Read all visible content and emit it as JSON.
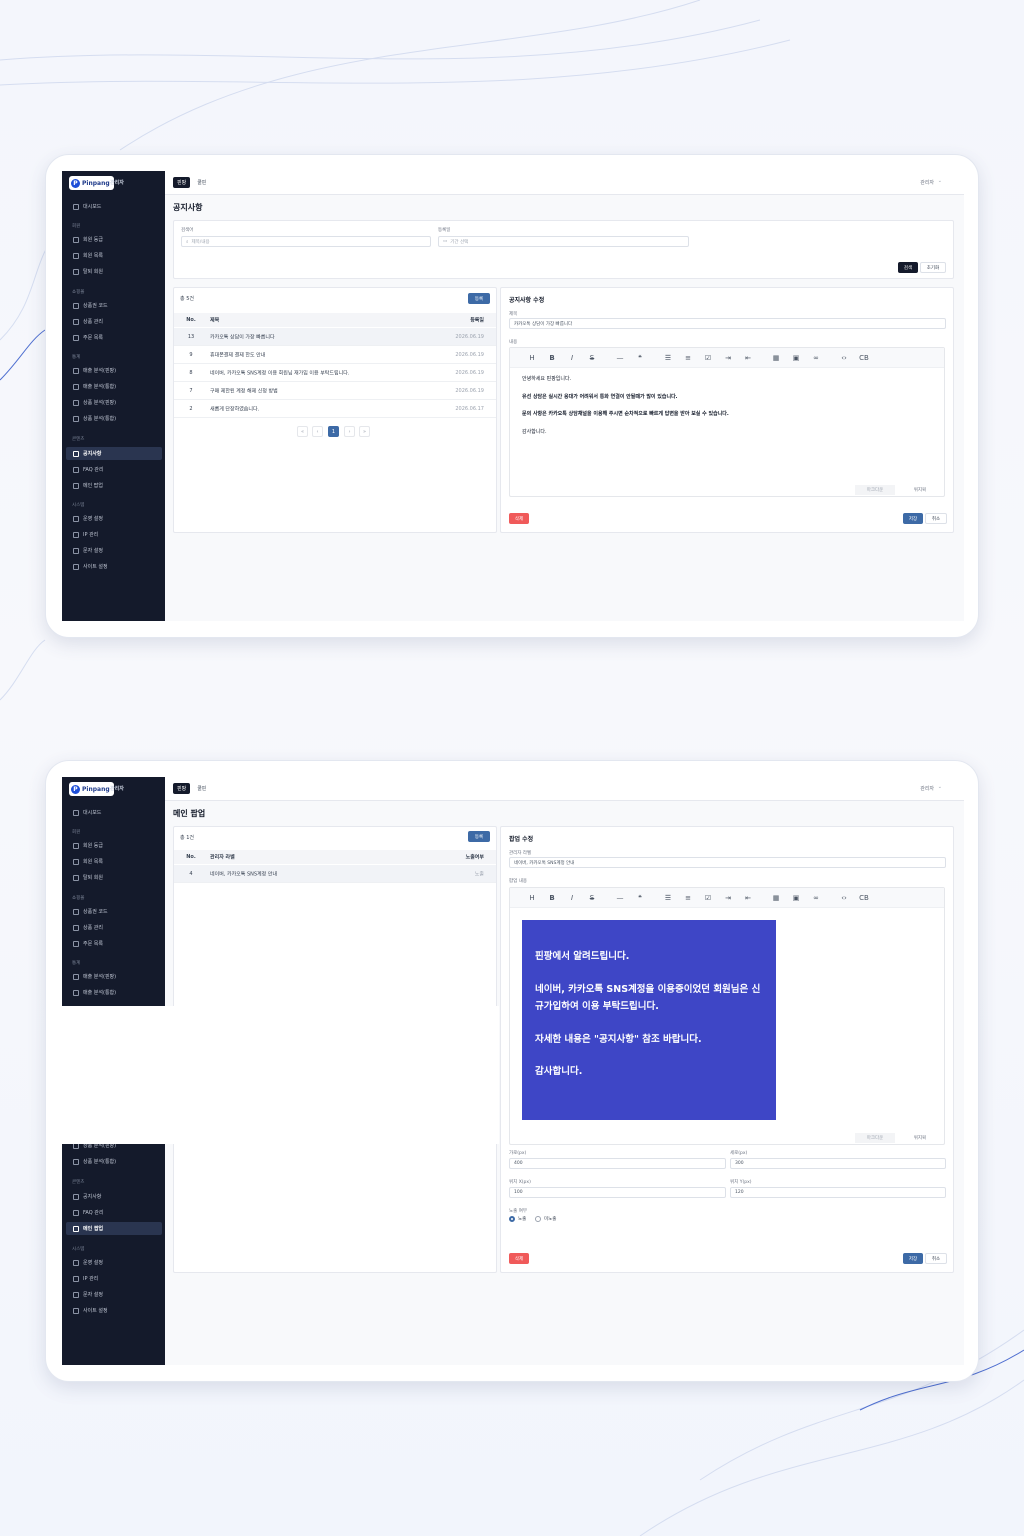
{
  "brand": {
    "logo_letter": "P",
    "logo_text": "Pinpang",
    "admin_tag": "관리자"
  },
  "topbar": {
    "tabs": [
      "핀팡",
      "쿨핀"
    ],
    "user": "관리자",
    "chevron": "⌄"
  },
  "sidebar": {
    "dashboard": "대시보드",
    "sections": {
      "member": "회원",
      "shopping": "쇼핑몰",
      "stats": "통계",
      "content": "콘텐츠",
      "system": "시스템"
    },
    "items": {
      "member_grade": "회원 등급",
      "member_list": "회원 목록",
      "withdrawn": "탈퇴 회원",
      "voucher_code": "상품권 코드",
      "product_mgmt": "상품 관리",
      "order_list": "주문 목록",
      "sales_pinpang": "매출 분석(핀팡)",
      "sales_total": "매출 분석(통합)",
      "product_pinpang": "상품 분석(핀팡)",
      "product_total": "상품 분석(통합)",
      "notice": "공지사항",
      "faq": "FAQ 관리",
      "main_popup": "메인 팝업",
      "operation": "운영 설정",
      "ip": "IP 관리",
      "sms": "문자 설정",
      "site": "사이트 설정"
    }
  },
  "screen1": {
    "page_title": "공지사항",
    "filter": {
      "keyword_label": "검색어",
      "keyword_placeholder": "제목/내용",
      "date_label": "등록일",
      "date_placeholder": "기간 선택",
      "search_button": "검색",
      "reset_button": "초기화"
    },
    "list": {
      "count": "총 5건",
      "register_button": "등록",
      "headers": [
        "No.",
        "제목",
        "등록일"
      ],
      "rows": [
        {
          "no": "13",
          "title": "카카오톡 상담이 가장 빠릅니다",
          "date": "2026.06.19"
        },
        {
          "no": "9",
          "title": "휴대폰결제 결제 한도 안내",
          "date": "2026.06.19"
        },
        {
          "no": "8",
          "title": "네이버, 카카오톡 SNS계정 이용 회원님 재가입 이용 부탁드립니다.",
          "date": "2026.06.19"
        },
        {
          "no": "7",
          "title": "구매 제한된 계정 해제 신청 방법",
          "date": "2026.06.19"
        },
        {
          "no": "2",
          "title": "새롭게 단장하였습니다.",
          "date": "2026.06.17"
        }
      ],
      "pagination": [
        "«",
        "‹",
        "1",
        "›",
        "»"
      ]
    },
    "edit": {
      "title": "공지사항 수정",
      "subject_label": "제목",
      "subject_value": "카카오톡 상담이 가장 빠릅니다",
      "content_label": "내용",
      "content": [
        "안녕하세요 핀팡입니다.",
        "유선 상담은 실시간 응대가 어려워서 통화 연결이 안될때가 많이 있습니다.",
        "문의 사항은 카카오톡 상담채널을 이용해 주시면 순차적으로 빠르게 답변을 받아 보실 수 있습니다.",
        "감사합니다."
      ],
      "markdown_tab": "마크다운",
      "wysiwyg_tab": "위지윅",
      "delete_button": "삭제",
      "save_button": "저장",
      "cancel_button": "취소"
    }
  },
  "screen2": {
    "page_title": "메인 팝업",
    "list": {
      "count": "총 1건",
      "register_button": "등록",
      "headers": [
        "No.",
        "관리자 라벨",
        "노출여부"
      ],
      "rows": [
        {
          "no": "4",
          "label": "네이버, 카카오톡 SNS계정 안내",
          "visible": "노출"
        }
      ]
    },
    "edit": {
      "title": "팝업 수정",
      "label_label": "관리자 라벨",
      "label_value": "네이버, 카카오톡 SNS계정 안내",
      "content_label": "팝업 내용",
      "popup_lines": [
        "핀팡에서 알려드립니다.",
        "네이버, 카카오톡 SNS계정을 이용중이었던 회원님은 신규가입하여 이용 부탁드립니다.",
        "자세한 내용은 \"공지사항\" 참조 바랍니다.",
        "감사합니다."
      ],
      "markdown_tab": "마크다운",
      "wysiwyg_tab": "위지윅",
      "width_label": "가로(px)",
      "width_value": "400",
      "height_label": "세로(px)",
      "height_value": "300",
      "pos_x_label": "위치 X(px)",
      "pos_x_value": "100",
      "pos_y_label": "위치 Y(px)",
      "pos_y_value": "120",
      "visible_label": "노출 여부",
      "visible_on": "노출",
      "visible_off": "미노출",
      "delete_button": "삭제",
      "save_button": "저장",
      "cancel_button": "취소"
    }
  },
  "toolbar_icons": [
    "heading-icon",
    "bold-icon",
    "italic-icon",
    "strike-icon",
    "hr-icon",
    "quote-icon",
    "bullet-list-icon",
    "ordered-list-icon",
    "task-icon",
    "indent-icon",
    "outdent-icon",
    "table-icon",
    "image-icon",
    "link-icon",
    "code-icon",
    "codeblock-icon"
  ],
  "colors": {
    "sidebar": "#141a2b",
    "primary": "#3d6aa6",
    "danger": "#f05a5a",
    "popup": "#3e46c6"
  }
}
